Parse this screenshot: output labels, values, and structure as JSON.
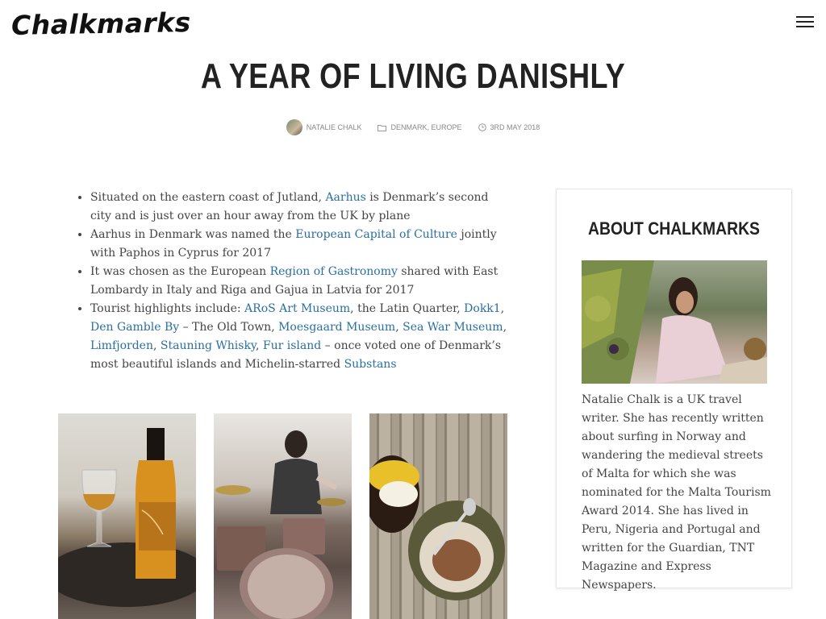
{
  "site": {
    "logo": "Chalkmarks"
  },
  "post": {
    "title": "A YEAR OF LIVING DANISHLY",
    "author": "NATALIE CHALK",
    "categories": [
      "DENMARK",
      "EUROPE"
    ],
    "date": "3RD MAY 2018"
  },
  "content": {
    "bullets": [
      {
        "parts": [
          {
            "t": "Situated on the eastern coast of Jutland, "
          },
          {
            "t": "Aarhus",
            "link": true
          },
          {
            "t": " is Denmark’s second city and is just over an hour away from the UK by plane"
          }
        ]
      },
      {
        "parts": [
          {
            "t": "Aarhus in Denmark was named the "
          },
          {
            "t": "European Capital of Culture",
            "link": true
          },
          {
            "t": " jointly with Paphos in Cyprus for 2017"
          }
        ]
      },
      {
        "parts": [
          {
            "t": "It was chosen as the European "
          },
          {
            "t": "Region of Gastronomy",
            "link": true
          },
          {
            "t": " shared with East Lombardy in Italy and Riga and Gajua in Latvia for 2017"
          }
        ]
      },
      {
        "parts": [
          {
            "t": "Tourist highlights include: "
          },
          {
            "t": "ARoS Art Museum",
            "link": true
          },
          {
            "t": ", the Latin Quarter, "
          },
          {
            "t": "Dokk1",
            "link": true
          },
          {
            "t": ", "
          },
          {
            "t": "Den Gamble By",
            "link": true
          },
          {
            "t": " – The Old Town, "
          },
          {
            "t": "Moesgaard Museum",
            "link": true
          },
          {
            "t": ", "
          },
          {
            "t": "Sea War Museum",
            "link": true
          },
          {
            "t": ", "
          },
          {
            "t": "Limfjorden",
            "link": true
          },
          {
            "t": ", "
          },
          {
            "t": "Stauning Whisky",
            "link": true
          },
          {
            "t": ", "
          },
          {
            "t": "Fur island",
            "link": true
          },
          {
            "t": " – once voted one of Denmark’s most beautiful islands and Michelin-starred "
          },
          {
            "t": "Substans",
            "link": true
          }
        ]
      }
    ]
  },
  "sidebar": {
    "widget_title": "ABOUT CHALKMARKS",
    "bio": "Natalie Chalk is a UK travel writer. She has recently written about surfing in Norway and wandering the medieval streets of Malta for which she was nominated for the Malta Tourism Award 2014. She has lived in Peru, Nigeria and Portugal and written for the Guardian, TNT Magazine and Express Newspapers."
  },
  "colors": {
    "link": "#2a6fa0",
    "text": "#444444",
    "title": "#222222",
    "meta": "#888888"
  },
  "icons": {
    "menu": "hamburger-menu-icon",
    "folder": "folder-icon",
    "clock": "clock-icon"
  }
}
